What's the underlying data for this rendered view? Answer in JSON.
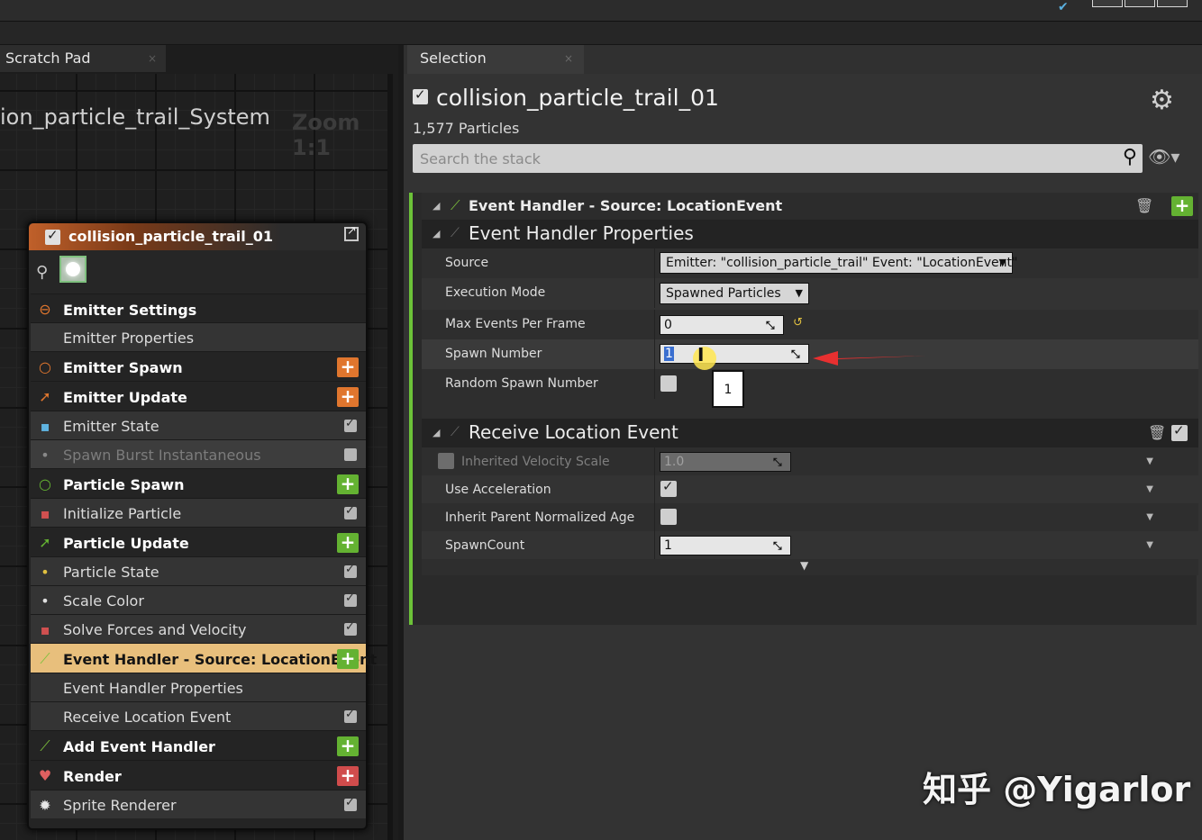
{
  "left_tab": {
    "label": "Scratch Pad",
    "close": "×"
  },
  "graph": {
    "title": "ion_particle_trail_System",
    "zoom": "Zoom 1:1"
  },
  "node": {
    "title": "collision_particle_trail_01",
    "rows": [
      {
        "label": "Emitter Settings",
        "kind": "sec",
        "icon": "emitter-settings-icon",
        "icon_glyph": "⊖",
        "icon_color": "#e0762e"
      },
      {
        "label": "Emitter Properties",
        "kind": "sub"
      },
      {
        "label": "Emitter Spawn",
        "kind": "sec",
        "icon": "emitter-spawn-icon",
        "icon_glyph": "○",
        "icon_color": "#e0762e",
        "plus": "orange"
      },
      {
        "label": "Emitter Update",
        "kind": "sec",
        "icon": "emitter-update-icon",
        "icon_glyph": "➚",
        "icon_color": "#e0762e",
        "plus": "orange"
      },
      {
        "label": "Emitter State",
        "kind": "sub",
        "icon": "module-icon",
        "icon_glyph": "▪",
        "icon_color": "#5fb3e0",
        "check": true
      },
      {
        "label": "Spawn Burst Instantaneous",
        "kind": "disabled",
        "icon": "dot-icon",
        "icon_glyph": "•",
        "icon_color": "#888",
        "check": false
      },
      {
        "label": "Particle Spawn",
        "kind": "sec",
        "icon": "particle-spawn-icon",
        "icon_glyph": "○",
        "icon_color": "#64b232",
        "plus": "green"
      },
      {
        "label": "Initialize Particle",
        "kind": "sub",
        "icon": "module-icon",
        "icon_glyph": "▪",
        "icon_color": "#d05050",
        "check": true
      },
      {
        "label": "Particle Update",
        "kind": "sec",
        "icon": "particle-update-icon",
        "icon_glyph": "➚",
        "icon_color": "#64b232",
        "plus": "green"
      },
      {
        "label": "Particle State",
        "kind": "sub",
        "icon": "dot-icon",
        "icon_glyph": "•",
        "icon_color": "#e0c040",
        "check": true
      },
      {
        "label": "Scale Color",
        "kind": "sub",
        "icon": "dot-icon",
        "icon_glyph": "•",
        "icon_color": "#e0e0e0",
        "check": true
      },
      {
        "label": "Solve Forces and Velocity",
        "kind": "sub",
        "icon": "module-icon",
        "icon_glyph": "▪",
        "icon_color": "#d05050",
        "check": true
      },
      {
        "label": "Event Handler - Source: LocationEvent",
        "kind": "hl",
        "icon": "event-handler-icon",
        "icon_glyph": "⟋",
        "icon_color": "#7dc03c",
        "plus": "green"
      },
      {
        "label": "Event Handler Properties",
        "kind": "sub"
      },
      {
        "label": "Receive Location Event",
        "kind": "sub",
        "check": true
      },
      {
        "label": "Add Event Handler",
        "kind": "sec",
        "icon": "add-event-handler-icon",
        "icon_glyph": "⟋",
        "icon_color": "#7dc03c",
        "plus": "green"
      },
      {
        "label": "Render",
        "kind": "sec",
        "icon": "render-icon",
        "icon_glyph": "♥",
        "icon_color": "#e06060",
        "plus": "red"
      },
      {
        "label": "Sprite Renderer",
        "kind": "sub",
        "icon": "sprite-icon",
        "icon_glyph": "✹",
        "icon_color": "#e8e8e8",
        "check": true
      }
    ]
  },
  "right_tab": {
    "label": "Selection",
    "close": "×"
  },
  "selection": {
    "emitter_title": "collision_particle_trail_01",
    "particles": "1,577 Particles",
    "search_placeholder": "Search the stack"
  },
  "event_handler": {
    "header": "Event Handler - Source: LocationEvent",
    "props_header": "Event Handler Properties",
    "props": {
      "source_label": "Source",
      "source_value": "Emitter: \"collision_particle_trail\" Event: \"LocationEvent\"",
      "exec_label": "Execution Mode",
      "exec_value": "Spawned Particles",
      "max_label": "Max Events Per Frame",
      "max_value": "0",
      "spawn_label": "Spawn Number",
      "spawn_value": "1",
      "random_label": "Random Spawn Number"
    },
    "tooltip": "1"
  },
  "receive": {
    "header": "Receive Location Event",
    "inherited_label": "Inherited Velocity Scale",
    "inherited_value": "1.0",
    "accel_label": "Use Acceleration",
    "age_label": "Inherit Parent Normalized Age",
    "count_label": "SpawnCount",
    "count_value": "1"
  },
  "watermark": "知乎 @Yigarlor",
  "colors": {
    "accent_green": "#6cc238",
    "highlight": "#e8bf7c",
    "emitter_orange": "#e0762e"
  }
}
